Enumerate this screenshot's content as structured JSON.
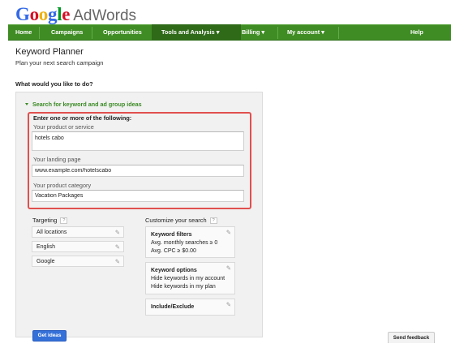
{
  "brand": {
    "google_letters": [
      {
        "ch": "G",
        "color": "#3369e8"
      },
      {
        "ch": "o",
        "color": "#d50f25"
      },
      {
        "ch": "o",
        "color": "#eeb211"
      },
      {
        "ch": "g",
        "color": "#3369e8"
      },
      {
        "ch": "l",
        "color": "#009925"
      },
      {
        "ch": "e",
        "color": "#d50f25"
      }
    ],
    "product": "AdWords"
  },
  "nav": {
    "items": [
      {
        "label": "Home"
      },
      {
        "label": "Campaigns"
      },
      {
        "label": "Opportunities"
      },
      {
        "label": "Tools and Analysis ▾",
        "active": true
      },
      {
        "label": "Billing ▾"
      },
      {
        "label": "My account ▾"
      },
      {
        "label": "Help"
      }
    ],
    "bar_color": "#3f8c24",
    "active_color": "#2e6a18"
  },
  "page": {
    "title": "Keyword Planner",
    "subtitle": "Plan your next search campaign",
    "question": "What would you like to do?"
  },
  "search_panel": {
    "toggle_label": "Search for keyword and ad group ideas",
    "enter_label": "Enter one or more of the following:",
    "product_label": "Your product or service",
    "product_value": "hotels cabo",
    "landing_label": "Your landing page",
    "landing_value": "www.example.com/hotelscabo",
    "category_label": "Your product category",
    "category_value": "Vacation Packages",
    "highlight_color": "#e0504f"
  },
  "targeting": {
    "label": "Targeting",
    "help": "?",
    "items": [
      "All locations",
      "English",
      "Google"
    ]
  },
  "customize": {
    "label": "Customize your search",
    "help": "?",
    "keyword_filters": {
      "title": "Keyword filters",
      "lines": [
        "Avg. monthly searches ≥ 0",
        "Avg. CPC ≥ $0.00"
      ]
    },
    "keyword_options": {
      "title": "Keyword options",
      "lines": [
        "Hide keywords in my account",
        "Hide keywords in my plan"
      ]
    },
    "include_exclude": {
      "title": "Include/Exclude"
    }
  },
  "actions": {
    "get_ideas": "Get ideas",
    "send_feedback": "Send feedback"
  },
  "icons": {
    "pencil": "✎"
  }
}
